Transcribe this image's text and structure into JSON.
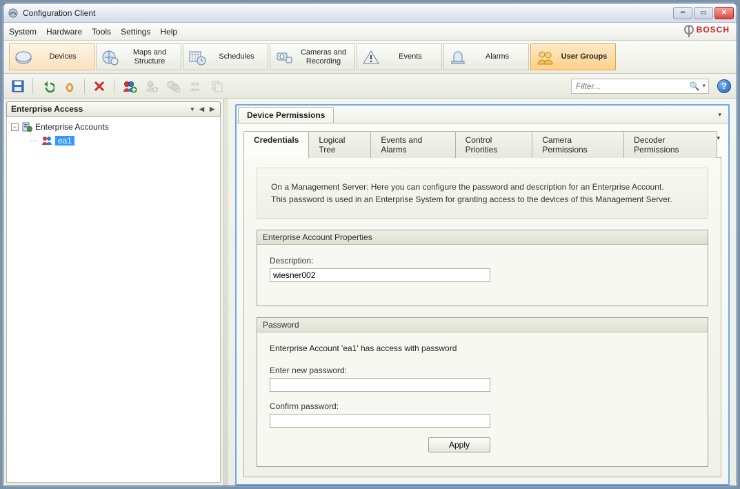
{
  "window": {
    "title": "Configuration Client"
  },
  "menu": {
    "system": "System",
    "hardware": "Hardware",
    "tools": "Tools",
    "settings": "Settings",
    "help": "Help"
  },
  "brand": "BOSCH",
  "nav": {
    "devices": "Devices",
    "maps": "Maps and Structure",
    "schedules": "Schedules",
    "cameras": "Cameras and Recording",
    "events": "Events",
    "alarms": "Alarms",
    "usergroups": "User Groups"
  },
  "filter": {
    "placeholder": "Filter..."
  },
  "side": {
    "title": "Enterprise Access",
    "root": "Enterprise Accounts",
    "child": "ea1"
  },
  "main": {
    "panel_title": "Device Permissions",
    "tabs": {
      "credentials": "Credentials",
      "logical": "Logical Tree",
      "events": "Events and Alarms",
      "control": "Control Priorities",
      "camera": "Camera Permissions",
      "decoder": "Decoder Permissions"
    },
    "info_line1": "On a Management Server: Here you can configure the password and description for an Enterprise Account.",
    "info_line2": "This password is used in an Enterprise System for granting access to the devices of this Management Server.",
    "group_props": {
      "title": "Enterprise Account Properties",
      "desc_label": "Description:",
      "desc_value": "wiesner002"
    },
    "group_pw": {
      "title": "Password",
      "access_text": "Enterprise Account 'ea1' has access with password",
      "new_label": "Enter new password:",
      "confirm_label": "Confirm password:",
      "apply": "Apply"
    }
  }
}
